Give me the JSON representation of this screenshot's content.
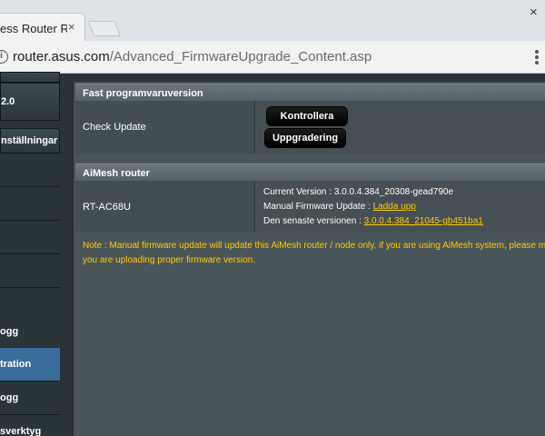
{
  "browser": {
    "tab_title": "ess Router RT",
    "tab_close": "×",
    "window_close": "×",
    "url_host": "router.asus.com",
    "url_path": "/Advanced_FirmwareUpgrade_Content.asp"
  },
  "sidebar": {
    "top_block_label": "2.0",
    "settings_header": "nställningar",
    "items": [
      {
        "label": ""
      },
      {
        "label": ""
      },
      {
        "label": ""
      },
      {
        "label": ""
      },
      {
        "label": ""
      },
      {
        "label": "ogg"
      },
      {
        "label": "tration",
        "active": true
      },
      {
        "label": "ogg"
      },
      {
        "label": "sverktyg"
      }
    ]
  },
  "fast_firmware": {
    "header": "Fast programvaruversion",
    "label": "Check Update",
    "check_button": "Kontrollera",
    "upgrade_button": "Uppgradering"
  },
  "aimesh": {
    "header": "AiMesh router",
    "model": "RT-AC68U",
    "current_version_label": "Current Version : ",
    "current_version": "3.0.0.4.384_20308-gead790e",
    "manual_update_label": "Manual Firmware Update : ",
    "manual_update_link": "Ladda upp",
    "latest_label": "Den senaste versionen : ",
    "latest_version": "3.0.0.4.384_21045-gb451ba1"
  },
  "note": {
    "line1": "Note : Manual firmware update will update this AiMesh router / node only, if you are using AiMesh system, please ma",
    "line2": "you are uploading proper firmware version."
  },
  "colors": {
    "accent_link": "#ffcc00",
    "active_nav": "#3b6d9a"
  }
}
